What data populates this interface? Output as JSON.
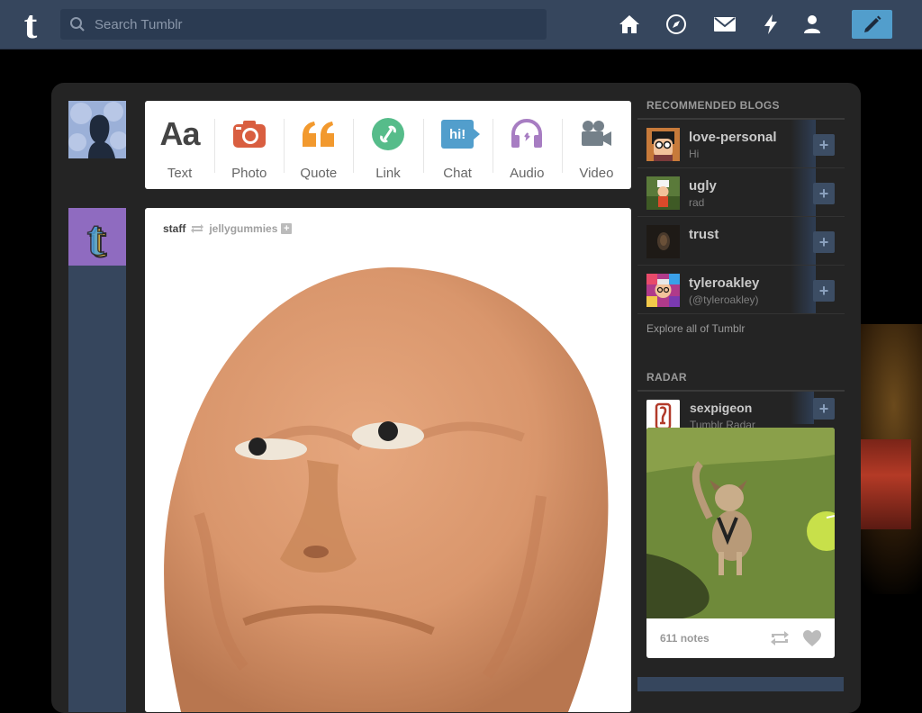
{
  "header": {
    "logo_glyph": "t",
    "search_placeholder": "Search Tumblr",
    "nav": [
      "home-icon",
      "compass-icon",
      "mail-icon",
      "lightning-icon",
      "person-icon"
    ],
    "compose_icon": "pencil-icon"
  },
  "post_types": [
    {
      "label": "Text",
      "icon": "text-icon",
      "color": "#444444"
    },
    {
      "label": "Photo",
      "icon": "camera-icon",
      "color": "#d95e40"
    },
    {
      "label": "Quote",
      "icon": "quote-icon",
      "color": "#f2992e"
    },
    {
      "label": "Link",
      "icon": "link-icon",
      "color": "#56bc8a"
    },
    {
      "label": "Chat",
      "icon": "chat-icon",
      "color": "#529ecc"
    },
    {
      "label": "Audio",
      "icon": "headphones-icon",
      "color": "#a77dc2"
    },
    {
      "label": "Video",
      "icon": "video-camera-icon",
      "color": "#748089"
    }
  ],
  "text_icon_glyph": "Aa",
  "chat_icon_glyph": "hi!",
  "post": {
    "author": "staff",
    "reblogged_from": "jellygummies"
  },
  "sidebar": {
    "recommended_title": "RECOMMENDED BLOGS",
    "blogs": [
      {
        "name": "love-personal",
        "sub": "Hi"
      },
      {
        "name": "ugly",
        "sub": "rad"
      },
      {
        "name": "trust",
        "sub": ""
      },
      {
        "name": "tyleroakley",
        "sub": "(@tyleroakley)"
      }
    ],
    "follow_glyph": "+",
    "explore": "Explore all of Tumblr",
    "radar_title": "RADAR",
    "radar": {
      "name": "sexpigeon",
      "sub": "Tumblr Radar",
      "notes": "611 notes"
    }
  },
  "colors": {
    "topbar": "#36465d",
    "accent": "#529ecc",
    "panel": "#242424"
  }
}
